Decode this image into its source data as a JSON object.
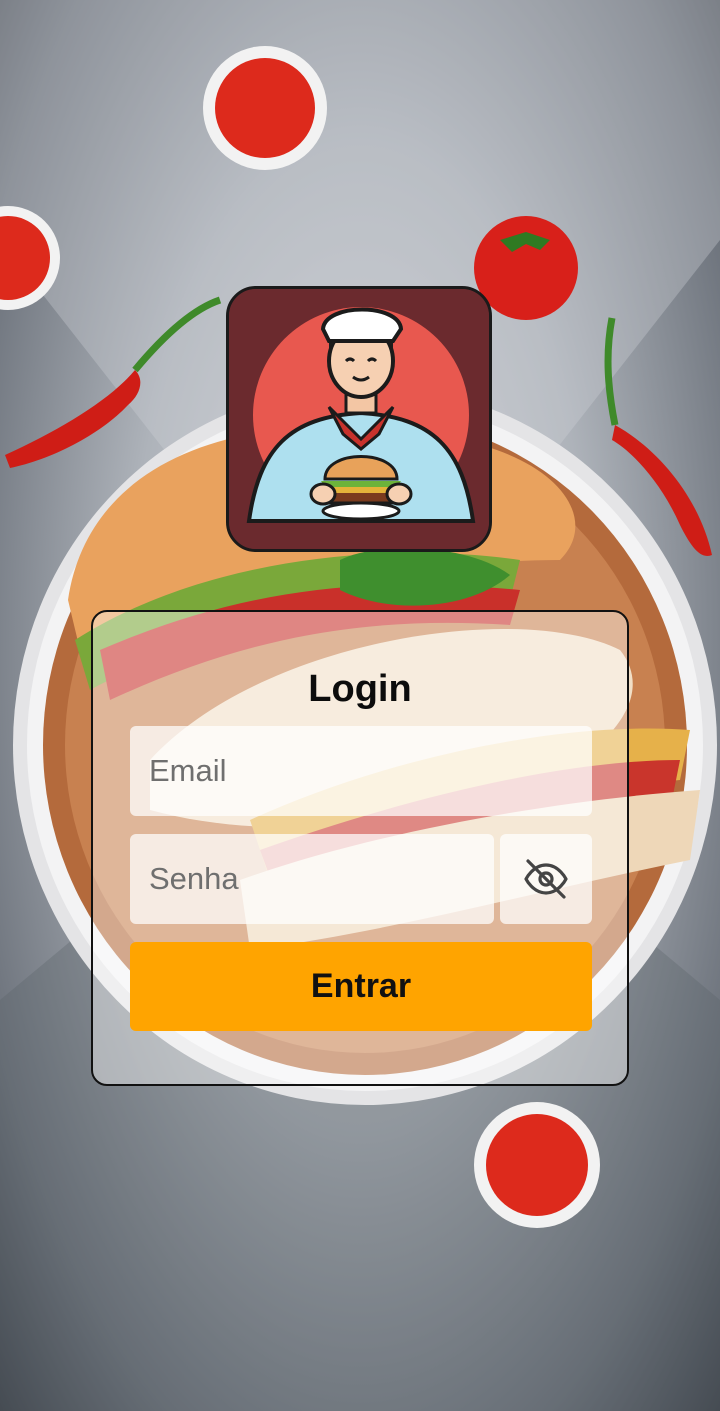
{
  "login": {
    "title": "Login",
    "email_placeholder": "Email",
    "password_placeholder": "Senha",
    "submit_label": "Entrar"
  },
  "icons": {
    "toggle_password": "eye-off-icon"
  },
  "colors": {
    "accent": "#ffa400",
    "logo_background": "#6b2a2e",
    "logo_circle": "#e8584f"
  }
}
